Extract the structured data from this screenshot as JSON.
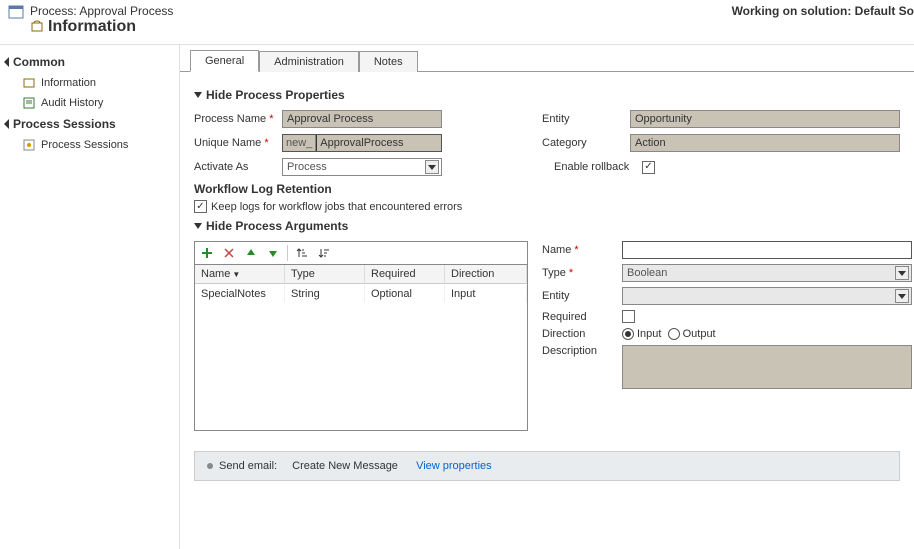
{
  "header": {
    "process_prefix": "Process:",
    "process_title": "Approval Process",
    "page_title": "Information",
    "working_on": "Working on solution: Default So"
  },
  "sidebar": {
    "groups": [
      {
        "title": "Common",
        "items": [
          {
            "label": "Information"
          },
          {
            "label": "Audit History"
          }
        ]
      },
      {
        "title": "Process Sessions",
        "items": [
          {
            "label": "Process Sessions"
          }
        ]
      }
    ]
  },
  "tabs": [
    {
      "label": "General"
    },
    {
      "label": "Administration"
    },
    {
      "label": "Notes"
    }
  ],
  "sections": {
    "props_title": "Hide Process Properties",
    "args_title": "Hide Process Arguments"
  },
  "props": {
    "process_name_label": "Process Name",
    "process_name_value": "Approval Process",
    "unique_name_label": "Unique Name",
    "unique_prefix": "new_",
    "unique_value": "ApprovalProcess",
    "activate_as_label": "Activate As",
    "activate_as_value": "Process",
    "entity_label": "Entity",
    "entity_value": "Opportunity",
    "category_label": "Category",
    "category_value": "Action",
    "enable_rollback_label": "Enable rollback",
    "log_retention_title": "Workflow Log Retention",
    "keep_logs_label": "Keep logs for workflow jobs that encountered errors"
  },
  "args_grid": {
    "columns": {
      "name": "Name",
      "type": "Type",
      "required": "Required",
      "direction": "Direction"
    },
    "rows": [
      {
        "name": "SpecialNotes",
        "type": "String",
        "required": "Optional",
        "direction": "Input"
      }
    ]
  },
  "arg_form": {
    "name_label": "Name",
    "name_value": "",
    "type_label": "Type",
    "type_value": "Boolean",
    "entity_label": "Entity",
    "entity_value": "",
    "required_label": "Required",
    "direction_label": "Direction",
    "direction_input": "Input",
    "direction_output": "Output",
    "description_label": "Description"
  },
  "step": {
    "prefix": "Send email:",
    "text": "Create New Message",
    "link": "View properties"
  }
}
